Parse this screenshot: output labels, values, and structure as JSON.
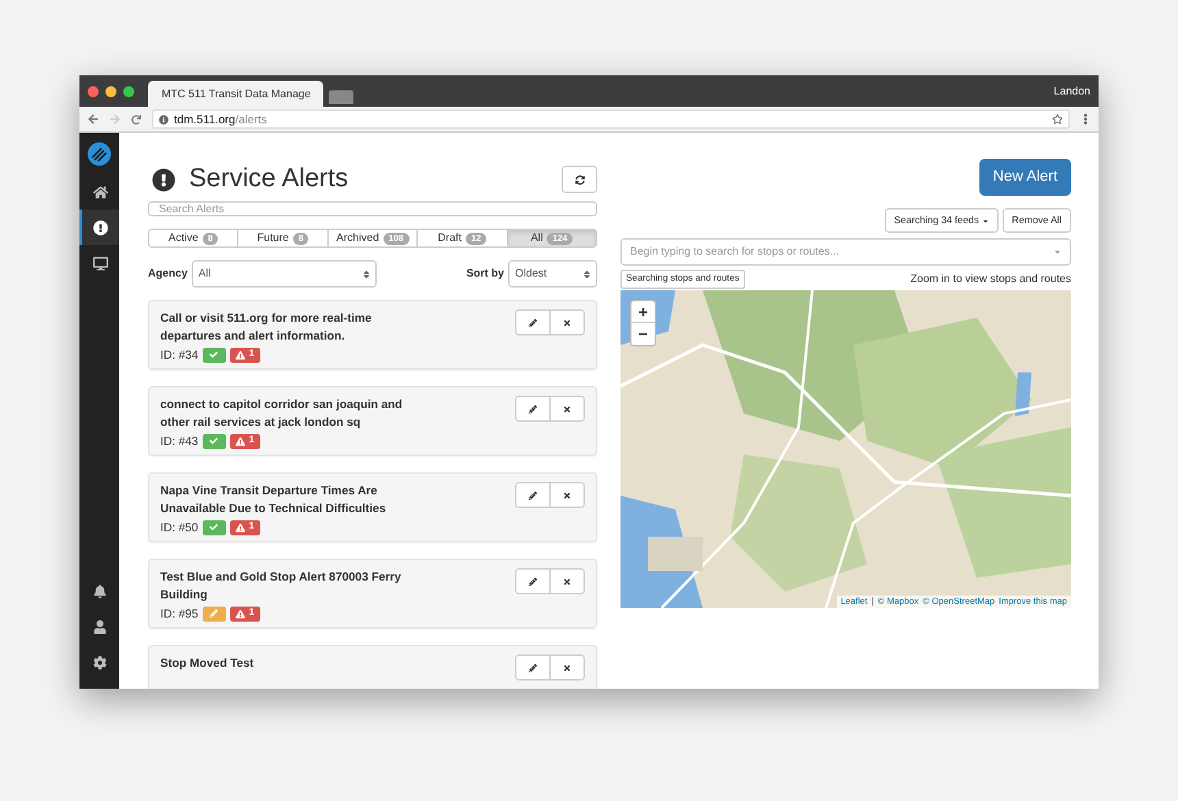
{
  "browser": {
    "tab_title": "MTC 511 Transit Data Manage",
    "user": "Landon",
    "url_host": "tdm.511.org",
    "url_path": "/alerts"
  },
  "sidebar": {
    "items": [
      {
        "selected": false
      },
      {
        "selected": true
      },
      {
        "selected": false
      }
    ]
  },
  "page": {
    "title": "Service Alerts",
    "search": {
      "placeholder": "Search Alerts"
    },
    "tabs": [
      {
        "label": "Active",
        "count": "8",
        "selected": false
      },
      {
        "label": "Future",
        "count": "8",
        "selected": false
      },
      {
        "label": "Archived",
        "count": "108",
        "selected": false
      },
      {
        "label": "Draft",
        "count": "12",
        "selected": false
      },
      {
        "label": "All",
        "count": "124",
        "selected": true
      }
    ],
    "agency": {
      "label": "Agency",
      "value": "All"
    },
    "sort": {
      "label": "Sort by",
      "value": "Oldest"
    },
    "alerts": [
      {
        "title": "Call or visit 511.org for more real-time departures and alert information.",
        "id": "ID: #34",
        "kind": "published",
        "warnings": "1"
      },
      {
        "title": "connect to capitol corridor san joaquin and other rail services at jack london sq",
        "id": "ID: #43",
        "kind": "published",
        "warnings": "1"
      },
      {
        "title": "Napa Vine Transit Departure Times Are Unavailable Due to Technical Difficulties",
        "id": "ID: #50",
        "kind": "published",
        "warnings": "1"
      },
      {
        "title": "Test Blue and Gold Stop Alert 870003 Ferry Building",
        "id": "ID: #95",
        "kind": "draft",
        "warnings": "1"
      },
      {
        "title": "Stop Moved Test"
      }
    ]
  },
  "right": {
    "new_button": "New Alert",
    "feeds_button": "Searching 34 feeds",
    "remove_button": "Remove All",
    "stop_search": {
      "placeholder": "Begin typing to search for stops or routes..."
    },
    "searching_label": "Searching stops and routes",
    "zoom_hint": "Zoom in to view stops and routes",
    "map": {
      "kind": "picture",
      "zoom_in": "+",
      "zoom_out": "−",
      "attribution": [
        {
          "kind": "link",
          "text": "Leaflet"
        },
        {
          "kind": "text",
          "text": "|"
        },
        {
          "kind": "link",
          "text": "© Mapbox"
        },
        {
          "kind": "link",
          "text": "© OpenStreetMap"
        },
        {
          "kind": "link",
          "text": "Improve this map"
        }
      ]
    }
  }
}
